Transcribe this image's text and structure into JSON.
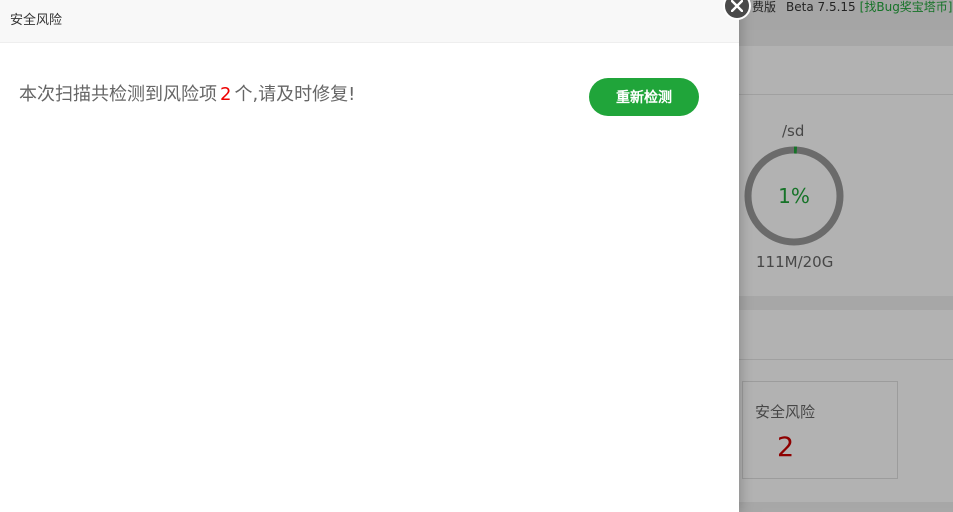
{
  "background": {
    "edition": {
      "prefix": "费版",
      "version": "Beta 7.5.15",
      "bug_link": "[找Bug奖宝塔币]"
    },
    "disk": {
      "path": "/sd",
      "usage_percent_label": "1%",
      "usage_fraction": 0.01,
      "size_label": "111M/20G"
    },
    "risk_card": {
      "label": "安全风险",
      "count": "2"
    }
  },
  "dialog": {
    "title": "安全风险",
    "summary": {
      "before": "本次扫描共检测到风险项",
      "count": "2",
      "after": "个,请及时修复!"
    },
    "rescan_label": "重新检测"
  },
  "colors": {
    "accent": "#20a53a",
    "danger": "#ee0000",
    "ring_track": "#9a9a9a"
  }
}
